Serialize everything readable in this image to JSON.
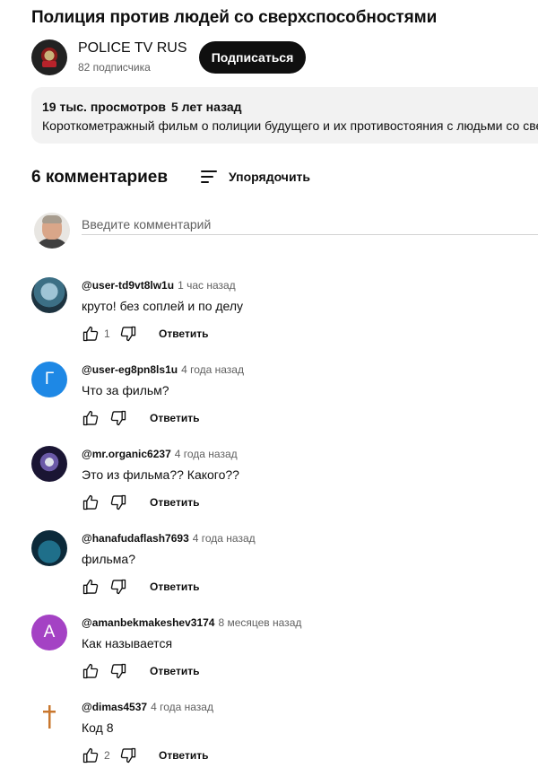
{
  "video": {
    "title": "Полиция против людей со сверхспособностями",
    "channel": "POLICE TV RUS",
    "subscribers": "82 подписчика",
    "subscribe_label": "Подписаться"
  },
  "description": {
    "views": "19 тыс. просмотров",
    "age": "5 лет назад",
    "text": "Короткометражный фильм о полиции будущего и их противостояния с людьми со сверхспособностями"
  },
  "comments_header": {
    "count_label": "6 комментариев",
    "sort_label": "Упорядочить"
  },
  "new_comment": {
    "placeholder": "Введите комментарий"
  },
  "comments": [
    {
      "author": "@user-td9vt8lw1u",
      "time": "1 час назад",
      "text": "круто! без соплей и по делу",
      "likes": "1",
      "reply": "Ответить",
      "avatar_letter": ""
    },
    {
      "author": "@user-eg8pn8ls1u",
      "time": "4 года назад",
      "text": "Что за фильм?",
      "likes": "",
      "reply": "Ответить",
      "avatar_letter": "Г",
      "avatar_color": "#1e88e5"
    },
    {
      "author": "@mr.organic6237",
      "time": "4 года назад",
      "text": "Это из фильма?? Какого??",
      "likes": "",
      "reply": "Ответить",
      "avatar_letter": ""
    },
    {
      "author": "@hanafudaflash7693",
      "time": "4 года назад",
      "text": "фильма?",
      "likes": "",
      "reply": "Ответить",
      "avatar_letter": ""
    },
    {
      "author": "@amanbekmakeshev3174",
      "time": "8 месяцев назад",
      "text": "Как называется",
      "likes": "",
      "reply": "Ответить",
      "avatar_letter": "А",
      "avatar_color": "#a442c4"
    },
    {
      "author": "@dimas4537",
      "time": "4 года назад",
      "text": "Код 8",
      "likes": "2",
      "reply": "Ответить",
      "avatar_letter": ""
    }
  ],
  "icons": {
    "like": "thumb-up-icon",
    "dislike": "thumb-down-icon",
    "sort": "sort-lines-icon"
  }
}
